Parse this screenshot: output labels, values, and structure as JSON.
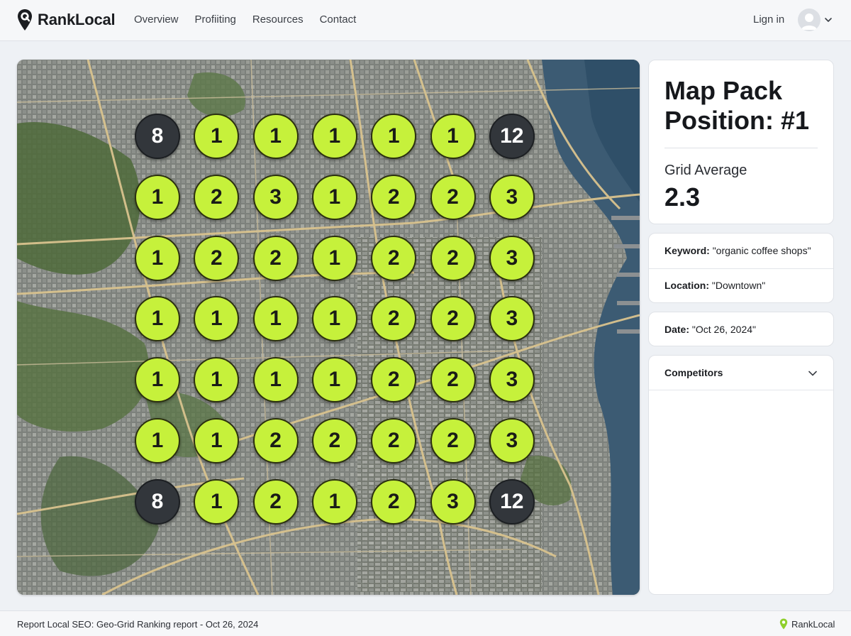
{
  "header": {
    "brand": "RankLocal",
    "nav": [
      "Overview",
      "Profiiting",
      "Resources",
      "Contact"
    ],
    "login_label": "Lign in"
  },
  "grid": {
    "rows": [
      [
        8,
        1,
        1,
        1,
        1,
        1,
        12
      ],
      [
        1,
        2,
        3,
        1,
        2,
        2,
        3
      ],
      [
        1,
        2,
        2,
        1,
        2,
        2,
        3
      ],
      [
        1,
        1,
        1,
        1,
        2,
        2,
        3
      ],
      [
        1,
        1,
        1,
        1,
        2,
        2,
        3
      ],
      [
        1,
        1,
        2,
        2,
        2,
        2,
        3
      ],
      [
        8,
        1,
        2,
        1,
        2,
        3,
        12
      ]
    ],
    "colors": {
      "ranked": "#c6f13b",
      "unranked": "#32363b"
    }
  },
  "summary": {
    "title": "Map Pack Position: #1",
    "avg_label": "Grid Average",
    "avg_value": "2.3"
  },
  "details": {
    "keyword_label": "Keyword:",
    "keyword_value": "\"organic coffee shops\"",
    "location_label": "Location:",
    "location_value": "\"Downtown\"",
    "date_label": "Date:",
    "date_value": "\"Oct 26, 2024\""
  },
  "competitors": {
    "title": "Competitors"
  },
  "footer": {
    "text": "Report Local SEO: Geo-Grid Ranking report - Oct 26, 2024",
    "brand": "RankLocal"
  },
  "icons": {
    "logo": "map-pin-icon",
    "avatar": "user-avatar-icon",
    "chevron": "chevron-down-icon"
  }
}
